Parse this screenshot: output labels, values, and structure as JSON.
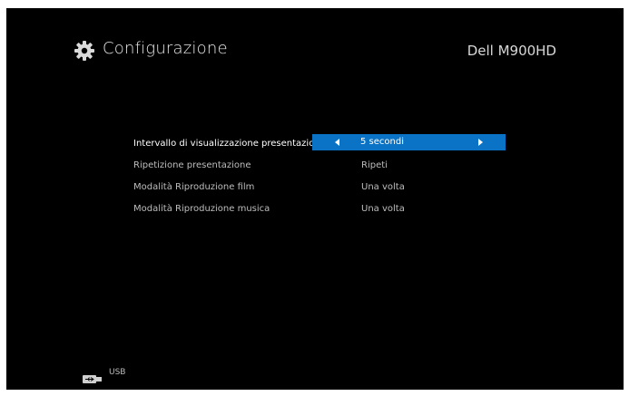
{
  "header": {
    "title": "Configurazione",
    "device": "Dell M900HD",
    "icon": "gear-icon"
  },
  "menu": {
    "items": [
      {
        "label": "Intervallo di visualizzazione presentazione",
        "value": "5 secondi",
        "selected": true
      },
      {
        "label": "Ripetizione presentazione",
        "value": "Ripeti",
        "selected": false
      },
      {
        "label": "Modalità Riproduzione film",
        "value": "Una volta",
        "selected": false
      },
      {
        "label": "Modalità Riproduzione musica",
        "value": "Una volta",
        "selected": false
      }
    ]
  },
  "footer": {
    "source_label": "USB",
    "icon": "usb-icon"
  },
  "colors": {
    "background": "#000000",
    "highlight": "#0a73c6",
    "text": "#bdbdbd"
  }
}
